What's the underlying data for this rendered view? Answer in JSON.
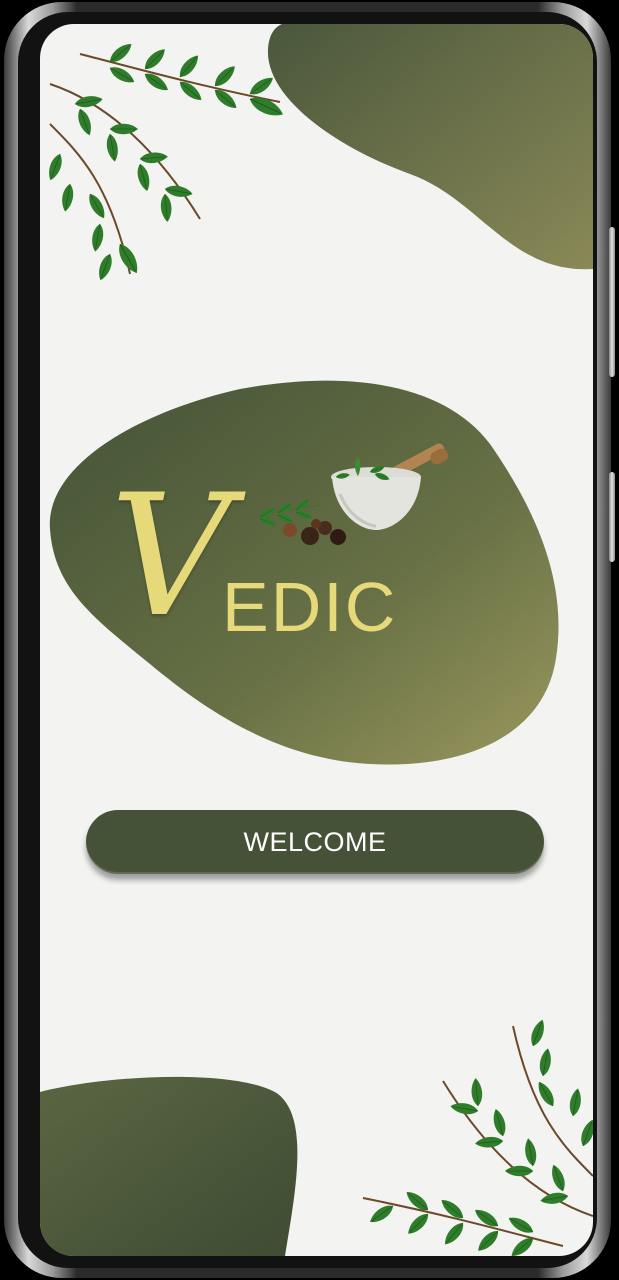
{
  "app": {
    "logo_initial": "V",
    "logo_rest": "EDIC"
  },
  "welcome_button": {
    "label": "WELCOME"
  },
  "colors": {
    "blob_green": "#4b5a3e",
    "blob_green_light": "#8f8d59",
    "logo_gold": "#e6d97a",
    "button_bg": "#465238",
    "screen_bg": "#f3f3f2"
  },
  "icons": [
    "curry-leaf-branch",
    "mortar-pestle-herbs"
  ]
}
